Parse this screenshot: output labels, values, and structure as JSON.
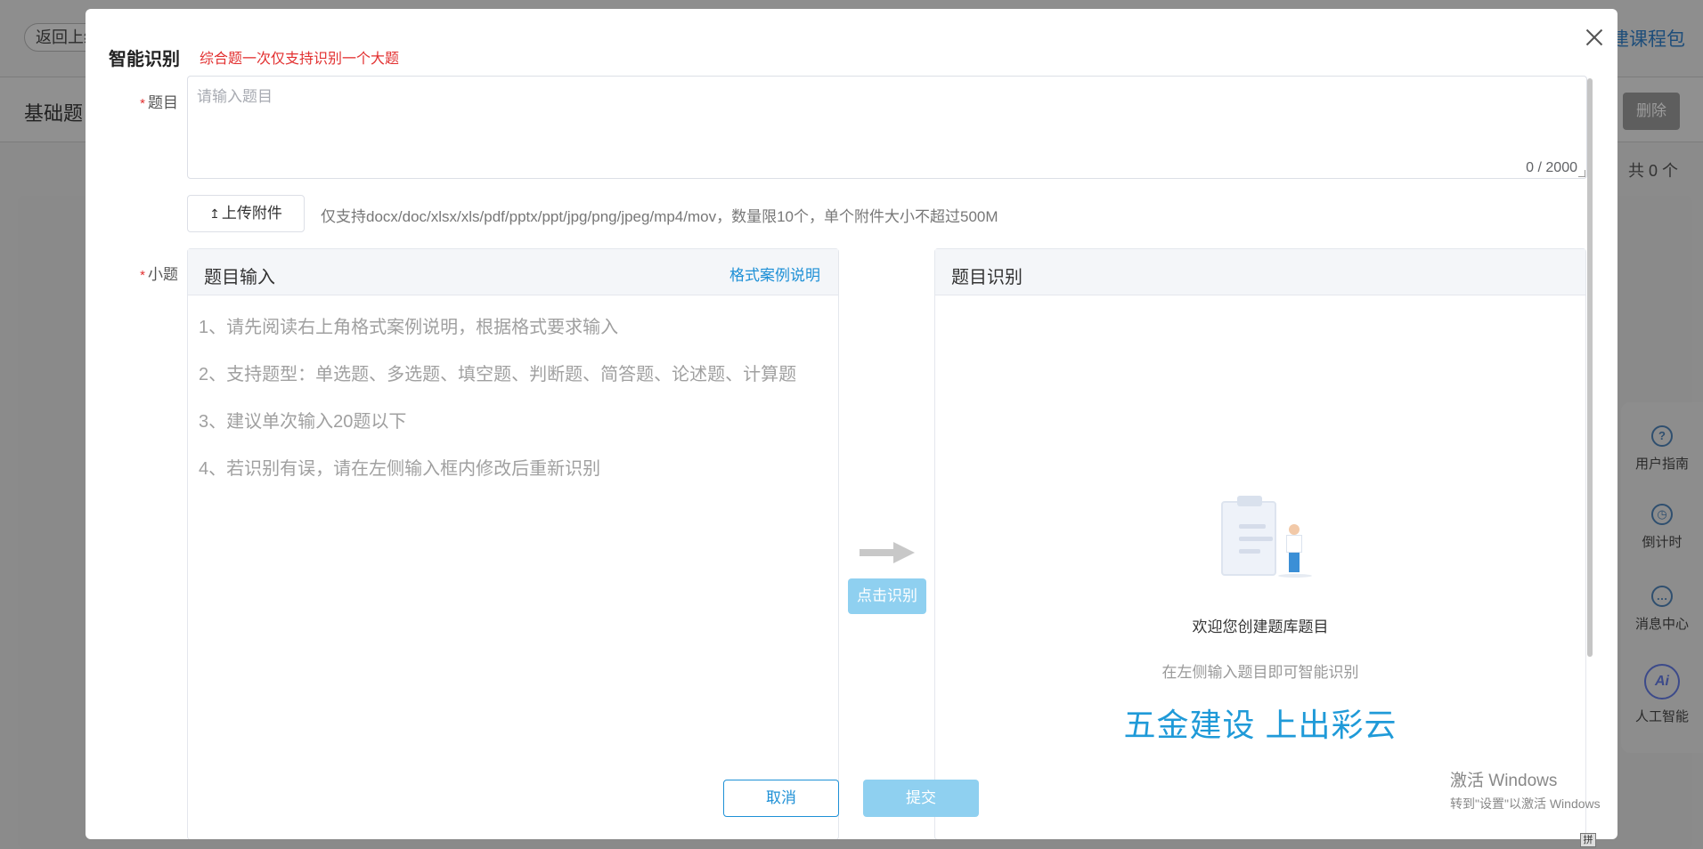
{
  "background": {
    "back_label": "返回上级",
    "course_package": "建课程包",
    "page_title": "基础题",
    "delete_label": "删除",
    "total_count": "共 0 个",
    "side_tools": [
      {
        "label": "用户指南",
        "icon": "question-circle-icon"
      },
      {
        "label": "倒计时",
        "icon": "alarm-clock-icon"
      },
      {
        "label": "消息中心",
        "icon": "chat-bubble-icon"
      },
      {
        "label": "人工智能",
        "icon": "ai-badge-icon"
      }
    ]
  },
  "modal": {
    "title": "智能识别",
    "subtitle": "综合题一次仅支持识别一个大题",
    "question": {
      "label": "题目",
      "placeholder": "请输入题目",
      "value": "",
      "char_count": "0 / 2000"
    },
    "upload": {
      "button_label": "上传附件",
      "hint": "仅支持docx/doc/xlsx/xls/pdf/pptx/ppt/jpg/png/jpeg/mp4/mov，数量限10个，单个附件大小不超过500M"
    },
    "sub_question_label": "小题",
    "input_panel": {
      "title": "题目输入",
      "format_link": "格式案例说明",
      "instructions": [
        "1、请先阅读右上角格式案例说明，根据格式要求输入",
        "2、支持题型：单选题、多选题、填空题、判断题、简答题、论述题、计算题",
        "3、建议单次输入20题以下",
        "4、若识别有误，请在左侧输入框内修改后重新识别"
      ]
    },
    "recognize_button": "点击识别",
    "result_panel": {
      "title": "题目识别",
      "welcome": "欢迎您创建题库题目",
      "welcome_sub": "在左侧输入题目即可智能识别",
      "slogan": "五金建设 上出彩云"
    },
    "cancel_label": "取消",
    "submit_label": "提交"
  },
  "system": {
    "activate_line1": "激活 Windows",
    "activate_line2": "转到\"设置\"以激活 Windows",
    "ime": "拼"
  },
  "colors": {
    "accent": "#1e90d6",
    "required": "#e23030",
    "disabled_button": "#8fd0f0",
    "overlay": "#8b8b8b"
  }
}
